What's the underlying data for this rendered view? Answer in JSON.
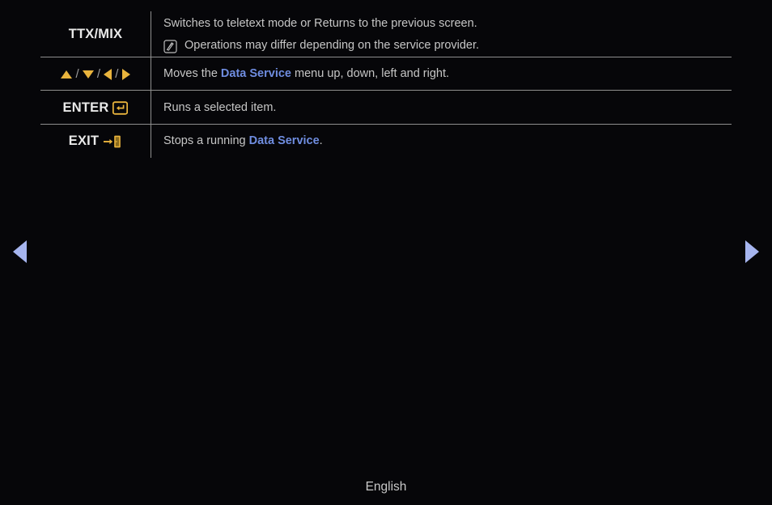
{
  "page": {
    "background_color": "#060609",
    "accent_gold": "#e9b43d",
    "accent_blue": "#6f8de0",
    "nav_arrow_color": "#a6b5ef",
    "text_color": "#c6c6c6",
    "key_label_color": "#e9e9e9",
    "border_color": "#8e8e8e"
  },
  "table": {
    "rows": [
      {
        "key_label": "TTX/MIX",
        "key_icons": [],
        "lines": [
          {
            "type": "plain",
            "segments": [
              {
                "text": "Switches to teletext mode or Returns to the previous screen.",
                "style": "normal"
              }
            ]
          },
          {
            "type": "note",
            "icon": "note-icon",
            "segments": [
              {
                "text": "Operations may differ depending on the service provider.",
                "style": "normal"
              }
            ]
          }
        ]
      },
      {
        "key_label": "",
        "key_icons": [
          "triangle-up-icon",
          "triangle-down-icon",
          "triangle-left-icon",
          "triangle-right-icon"
        ],
        "key_separator": "/",
        "lines": [
          {
            "type": "plain",
            "segments": [
              {
                "text": "Moves the ",
                "style": "normal"
              },
              {
                "text": "Data Service",
                "style": "highlight"
              },
              {
                "text": " menu up, down, left and right.",
                "style": "normal"
              }
            ]
          }
        ]
      },
      {
        "key_label": "ENTER",
        "key_icons": [
          "enter-return-icon"
        ],
        "lines": [
          {
            "type": "plain",
            "segments": [
              {
                "text": "Runs a selected item.",
                "style": "normal"
              }
            ]
          }
        ]
      },
      {
        "key_label": "EXIT",
        "key_icons": [
          "exit-arrow-door-icon"
        ],
        "lines": [
          {
            "type": "plain",
            "segments": [
              {
                "text": "Stops a running ",
                "style": "normal"
              },
              {
                "text": "Data Service",
                "style": "highlight"
              },
              {
                "text": ".",
                "style": "normal"
              }
            ]
          }
        ]
      }
    ]
  },
  "navigation": {
    "prev_label": "Previous page",
    "next_label": "Next page",
    "prev_icon": "triangle-left-icon",
    "next_icon": "triangle-right-icon"
  },
  "footer": {
    "language": "English"
  }
}
